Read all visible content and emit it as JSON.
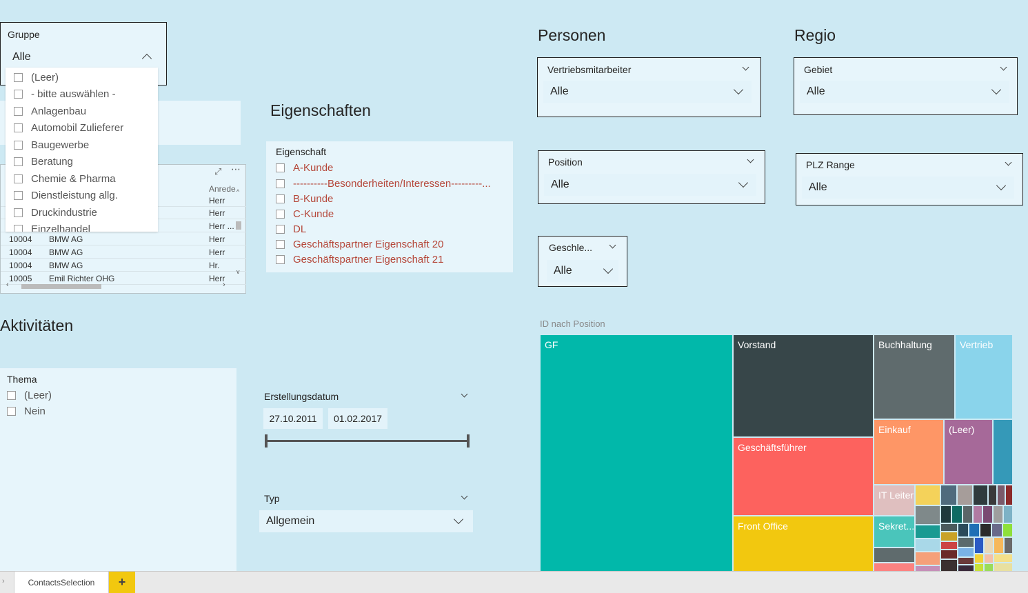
{
  "gruppe": {
    "title": "Gruppe",
    "value": "Alle",
    "options": [
      "(Leer)",
      "- bitte auswählen -",
      "Anlagenbau",
      "Automobil Zulieferer",
      "Baugewerbe",
      "Beratung",
      "Chemie & Pharma",
      "Dienstleistung allg.",
      "Druckindustrie",
      "Einzelhandel"
    ]
  },
  "table": {
    "header_anrede": "Anrede",
    "rows": [
      {
        "id": "",
        "name": "",
        "anrede": "Herr"
      },
      {
        "id": "",
        "name": "",
        "anrede": "Herr"
      },
      {
        "id": "",
        "name": "",
        "anrede": "Herr ..."
      },
      {
        "id": "10004",
        "name": "BMW AG",
        "anrede": "Herr"
      },
      {
        "id": "10004",
        "name": "BMW AG",
        "anrede": "Herr"
      },
      {
        "id": "10004",
        "name": "BMW AG",
        "anrede": "Hr."
      },
      {
        "id": "10005",
        "name": "Emil Richter OHG",
        "anrede": "Herr"
      }
    ]
  },
  "eigenschaften": {
    "heading": "Eigenschaften",
    "title": "Eigenschaft",
    "options": [
      "A-Kunde",
      "----------Besonderheiten/Interessen---------...",
      "B-Kunde",
      "C-Kunde",
      "DL",
      "Geschäftspartner Eigenschaft 20",
      "Geschäftspartner Eigenschaft 21"
    ]
  },
  "personen": {
    "heading": "Personen",
    "vertrieb": {
      "title": "Vertriebsmitarbeiter",
      "value": "Alle"
    },
    "position": {
      "title": "Position",
      "value": "Alle"
    },
    "geschlecht": {
      "title": "Geschle...",
      "value": "Alle"
    }
  },
  "regio": {
    "heading": "Regio",
    "gebiet": {
      "title": "Gebiet",
      "value": "Alle"
    },
    "plz": {
      "title": "PLZ Range",
      "value": "Alle"
    }
  },
  "aktivitaeten": {
    "heading": "Aktivitäten",
    "thema_title": "Thema",
    "thema_options": [
      "(Leer)",
      "Nein"
    ]
  },
  "erstellungsdatum": {
    "title": "Erstellungsdatum",
    "start": "27.10.2011",
    "end": "01.02.2017"
  },
  "typ": {
    "title": "Typ",
    "value": "Allgemein"
  },
  "treemap": {
    "title": "ID nach Position",
    "labels": {
      "gf": "GF",
      "vorstand": "Vorstand",
      "buchhaltung": "Buchhaltung",
      "vertrieb": "Vertrieb",
      "geschaeftsfuehrer": "Geschäftsführer",
      "einkauf": "Einkauf",
      "leer": "(Leer)",
      "it_leiter": "IT Leiter",
      "front_office": "Front Office",
      "sekret": "Sekret..."
    },
    "colors": {
      "gf": "#01b8aa",
      "vorstand": "#374649",
      "buchhaltung": "#5f6b6d",
      "vertrieb": "#8ad4eb",
      "geschaeftsfuehrer": "#fd625e",
      "einkauf": "#fe9666",
      "leer": "#a66999",
      "teal": "#3599b8",
      "it_leiter": "#dfbfbf",
      "front_office": "#f2c80f",
      "sekret": "#4ac5bb"
    }
  },
  "tabs": {
    "page": "ContactsSelection",
    "add": "+"
  }
}
